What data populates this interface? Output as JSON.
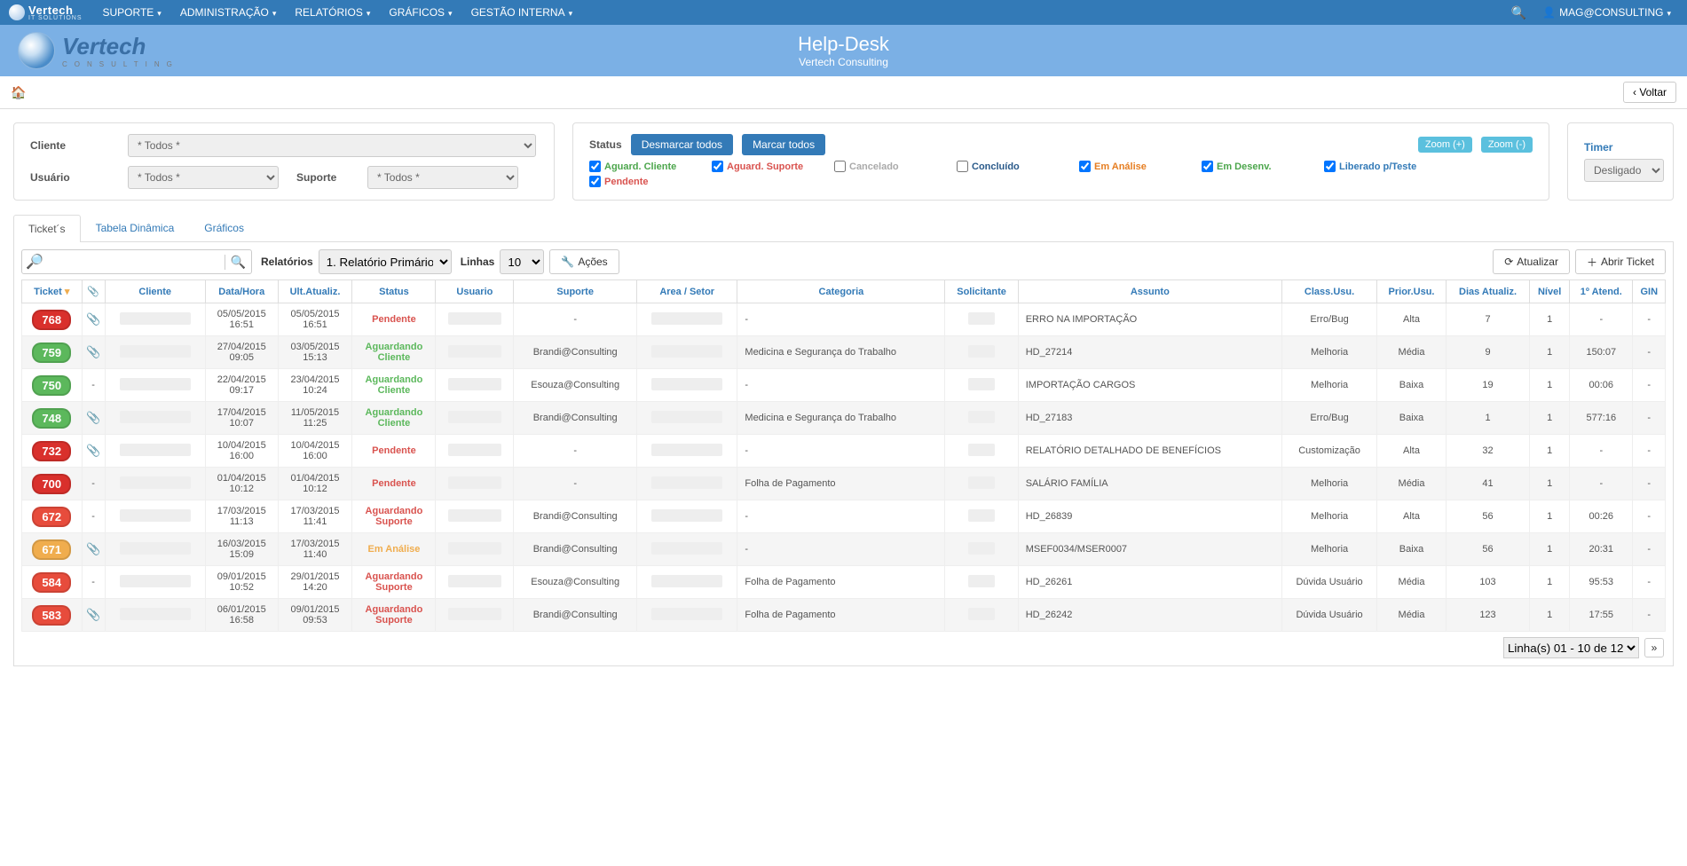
{
  "nav": {
    "brand": "Vertech",
    "brand_sub": "IT SOLUTIONS",
    "items": [
      "SUPORTE",
      "ADMINISTRAÇÃO",
      "RELATÓRIOS",
      "GRÁFICOS",
      "GESTÃO INTERNA"
    ],
    "user": "MAG@CONSULTING"
  },
  "title": {
    "logo_main": "Vertech",
    "logo_sub": "CONSULTING",
    "t1": "Help-Desk",
    "t2": "Vertech Consulting"
  },
  "crumb": {
    "back": "Voltar"
  },
  "filters": {
    "cliente_label": "Cliente",
    "cliente_value": "* Todos *",
    "usuario_label": "Usuário",
    "usuario_value": "* Todos *",
    "suporte_label": "Suporte",
    "suporte_value": "* Todos *",
    "status_label": "Status",
    "btn_unmark": "Desmarcar todos",
    "btn_mark": "Marcar todos",
    "zoom_in": "Zoom (+)",
    "zoom_out": "Zoom (-)",
    "statuses": [
      {
        "label": "Aguard. Cliente",
        "cls": "c-green",
        "checked": true
      },
      {
        "label": "Aguard. Suporte",
        "cls": "c-red",
        "checked": true
      },
      {
        "label": "Cancelado",
        "cls": "c-grey",
        "checked": false
      },
      {
        "label": "Concluído",
        "cls": "c-dblue",
        "checked": false
      },
      {
        "label": "Em Análise",
        "cls": "c-orange",
        "checked": true
      },
      {
        "label": "Em Desenv.",
        "cls": "c-green",
        "checked": true
      },
      {
        "label": "Liberado p/Teste",
        "cls": "c-blue",
        "checked": true
      },
      {
        "label": "Pendente",
        "cls": "c-red",
        "checked": true
      }
    ],
    "timer_label": "Timer",
    "timer_value": "Desligado"
  },
  "tabs": [
    "Ticket´s",
    "Tabela Dinâmica",
    "Gráficos"
  ],
  "toolbar": {
    "rel_label": "Relatórios",
    "rel_value": "1. Relatório Primário",
    "linhas_label": "Linhas",
    "linhas_value": "10",
    "acoes": "Ações",
    "atualizar": "Atualizar",
    "abrir": "Abrir Ticket"
  },
  "headers": [
    "Ticket",
    "",
    "Cliente",
    "Data/Hora",
    "Ult.Atualiz.",
    "Status",
    "Usuario",
    "Suporte",
    "Area / Setor",
    "Categoria",
    "Solicitante",
    "Assunto",
    "Class.Usu.",
    "Prior.Usu.",
    "Dias Atualiz.",
    "Nível",
    "1º Atend.",
    "GIN"
  ],
  "rows": [
    {
      "n": "768",
      "bg": "bg-red",
      "att": true,
      "dt": "05/05/2015 16:51",
      "ut": "05/05/2015 16:51",
      "st": "Pendente",
      "stc": "stat-pend",
      "sup": "-",
      "cat": "-",
      "ass": "ERRO NA IMPORTAÇÃO",
      "cl": "Erro/Bug",
      "pr": "Alta",
      "di": "7",
      "nv": "1",
      "at": "-",
      "gi": "-"
    },
    {
      "n": "759",
      "bg": "bg-green",
      "att": true,
      "dt": "27/04/2015 09:05",
      "ut": "03/05/2015 15:13",
      "st": "Aguardando Cliente",
      "stc": "stat-agcl",
      "sup": "Brandi@Consulting",
      "cat": "Medicina e Segurança do Trabalho",
      "ass": "HD_27214",
      "cl": "Melhoria",
      "pr": "Média",
      "di": "9",
      "nv": "1",
      "at": "150:07",
      "gi": "-"
    },
    {
      "n": "750",
      "bg": "bg-green",
      "att": false,
      "dt": "22/04/2015 09:17",
      "ut": "23/04/2015 10:24",
      "st": "Aguardando Cliente",
      "stc": "stat-agcl",
      "sup": "Esouza@Consulting",
      "cat": "-",
      "ass": "IMPORTAÇÃO CARGOS",
      "cl": "Melhoria",
      "pr": "Baixa",
      "di": "19",
      "nv": "1",
      "at": "00:06",
      "gi": "-"
    },
    {
      "n": "748",
      "bg": "bg-green",
      "att": true,
      "dt": "17/04/2015 10:07",
      "ut": "11/05/2015 11:25",
      "st": "Aguardando Cliente",
      "stc": "stat-agcl",
      "sup": "Brandi@Consulting",
      "cat": "Medicina e Segurança do Trabalho",
      "ass": "HD_27183",
      "cl": "Erro/Bug",
      "pr": "Baixa",
      "di": "1",
      "nv": "1",
      "at": "577:16",
      "gi": "-"
    },
    {
      "n": "732",
      "bg": "bg-red",
      "att": true,
      "dt": "10/04/2015 16:00",
      "ut": "10/04/2015 16:00",
      "st": "Pendente",
      "stc": "stat-pend",
      "sup": "-",
      "cat": "-",
      "ass": "RELATÓRIO DETALHADO DE BENEFÍCIOS",
      "cl": "Customização",
      "pr": "Alta",
      "di": "32",
      "nv": "1",
      "at": "-",
      "gi": "-"
    },
    {
      "n": "700",
      "bg": "bg-red",
      "att": false,
      "dt": "01/04/2015 10:12",
      "ut": "01/04/2015 10:12",
      "st": "Pendente",
      "stc": "stat-pend",
      "sup": "-",
      "cat": "Folha de Pagamento",
      "ass": "SALÁRIO FAMÍLIA",
      "cl": "Melhoria",
      "pr": "Média",
      "di": "41",
      "nv": "1",
      "at": "-",
      "gi": "-"
    },
    {
      "n": "672",
      "bg": "bg-red2",
      "att": false,
      "dt": "17/03/2015 11:13",
      "ut": "17/03/2015 11:41",
      "st": "Aguardando Suporte",
      "stc": "stat-agsp",
      "sup": "Brandi@Consulting",
      "cat": "-",
      "ass": "HD_26839",
      "cl": "Melhoria",
      "pr": "Alta",
      "di": "56",
      "nv": "1",
      "at": "00:26",
      "gi": "-"
    },
    {
      "n": "671",
      "bg": "bg-orange",
      "att": true,
      "dt": "16/03/2015 15:09",
      "ut": "17/03/2015 11:40",
      "st": "Em Análise",
      "stc": "stat-anal",
      "sup": "Brandi@Consulting",
      "cat": "-",
      "ass": "MSEF0034/MSER0007",
      "cl": "Melhoria",
      "pr": "Baixa",
      "di": "56",
      "nv": "1",
      "at": "20:31",
      "gi": "-"
    },
    {
      "n": "584",
      "bg": "bg-red2",
      "att": false,
      "dt": "09/01/2015 10:52",
      "ut": "29/01/2015 14:20",
      "st": "Aguardando Suporte",
      "stc": "stat-agsp",
      "sup": "Esouza@Consulting",
      "cat": "Folha de Pagamento",
      "ass": "HD_26261",
      "cl": "Dúvida Usuário",
      "pr": "Média",
      "di": "103",
      "nv": "1",
      "at": "95:53",
      "gi": "-"
    },
    {
      "n": "583",
      "bg": "bg-red2",
      "att": true,
      "dt": "06/01/2015 16:58",
      "ut": "09/01/2015 09:53",
      "st": "Aguardando Suporte",
      "stc": "stat-agsp",
      "sup": "Brandi@Consulting",
      "cat": "Folha de Pagamento",
      "ass": "HD_26242",
      "cl": "Dúvida Usuário",
      "pr": "Média",
      "di": "123",
      "nv": "1",
      "at": "17:55",
      "gi": "-"
    }
  ],
  "pager": {
    "text": "Linha(s) 01 - 10 de 12"
  }
}
